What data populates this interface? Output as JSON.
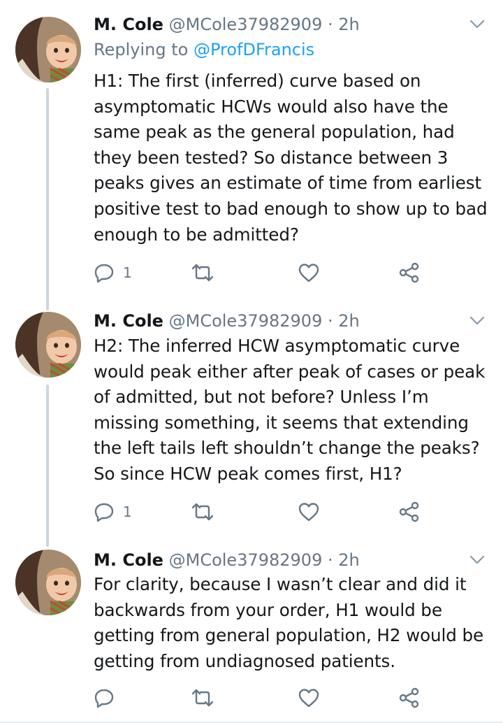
{
  "tweets": [
    {
      "name": "M. Cole",
      "handle": "@MCole37982909",
      "separator": "·",
      "time": "2h",
      "replying_prefix": "Replying to",
      "replying_to": "@ProfDFrancis",
      "text": "H1: The first (inferred) curve based on asymptomatic HCWs would also have the same peak as the general population, had they been tested? So distance between 3 peaks gives an estimate of time from earliest positive test to bad enough to show up to bad enough to be admitted?",
      "reply_count": "1"
    },
    {
      "name": "M. Cole",
      "handle": "@MCole37982909",
      "separator": "·",
      "time": "2h",
      "text": "H2: The inferred HCW asymptomatic curve would peak either after peak of cases or peak of admitted, but not before? Unless I’m missing something, it seems that extending the left tails left shouldn’t change the peaks? So since HCW peak comes first, H1?",
      "reply_count": "1"
    },
    {
      "name": "M. Cole",
      "handle": "@MCole37982909",
      "separator": "·",
      "time": "2h",
      "text": "For clarity, because I wasn’t clear and did it backwards from your order, H1 would be getting from general population, H2 would be getting from undiagnosed patients.",
      "reply_count": ""
    }
  ],
  "colors": {
    "text": "#14171a",
    "secondary": "#657786",
    "link": "#1da1f2",
    "thread_line": "#ccd6dd",
    "divider": "#e6ecf0"
  },
  "icons": [
    "chevron-down-icon",
    "reply-icon",
    "retweet-icon",
    "like-icon",
    "share-icon"
  ]
}
